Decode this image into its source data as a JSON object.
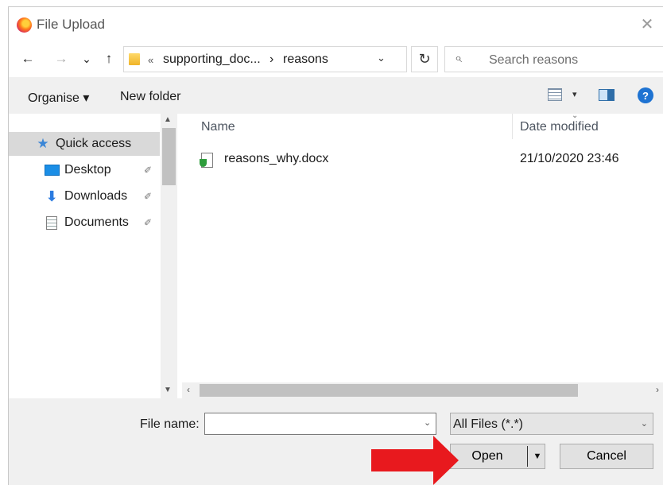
{
  "window": {
    "title": "File Upload",
    "close_glyph": "✕"
  },
  "address_bar": {
    "back_glyph": "←",
    "forward_glyph": "→",
    "recent_glyph": "⌄",
    "up_glyph": "↑",
    "overflow_glyph": "«",
    "crumbs": [
      "supporting_doc...",
      "reasons"
    ],
    "separator_glyph": "›",
    "dropdown_glyph": "⌄",
    "refresh_glyph": "↻",
    "search_placeholder": "Search reasons",
    "search_glyph": "⌕"
  },
  "toolbar": {
    "organise_label": "Organise ▾",
    "new_folder_label": "New folder",
    "view_dropdown_glyph": "▾",
    "help_glyph": "?"
  },
  "nav_pane": {
    "items": [
      {
        "label": "Quick access",
        "icon": "star-icon",
        "selected": true,
        "pinned": false
      },
      {
        "label": "Desktop",
        "icon": "desktop-icon",
        "selected": false,
        "pinned": true
      },
      {
        "label": "Downloads",
        "icon": "download-arrow-icon",
        "selected": false,
        "pinned": true
      },
      {
        "label": "Documents",
        "icon": "documents-icon",
        "selected": false,
        "pinned": true
      }
    ],
    "pin_glyph": "📌",
    "scroll_up_glyph": "▲",
    "scroll_down_glyph": "▼"
  },
  "file_list": {
    "columns": [
      "Name",
      "Date modified"
    ],
    "sort_glyph": "⌄",
    "files": [
      {
        "name": "reasons_why.docx",
        "date_modified": "21/10/2020 23:46",
        "icon": "docx-icon"
      }
    ],
    "scroll_left_glyph": "‹",
    "scroll_right_glyph": "›"
  },
  "bottom": {
    "file_name_label": "File name:",
    "file_name_value": "",
    "file_name_dd_glyph": "⌄",
    "filter_value": "All Files (*.*)",
    "filter_dd_glyph": "⌄",
    "open_label": "Open",
    "open_split_glyph": "▼",
    "cancel_label": "Cancel"
  },
  "colors": {
    "accent": "#1e73d2",
    "annotation_arrow": "#e8191e"
  }
}
